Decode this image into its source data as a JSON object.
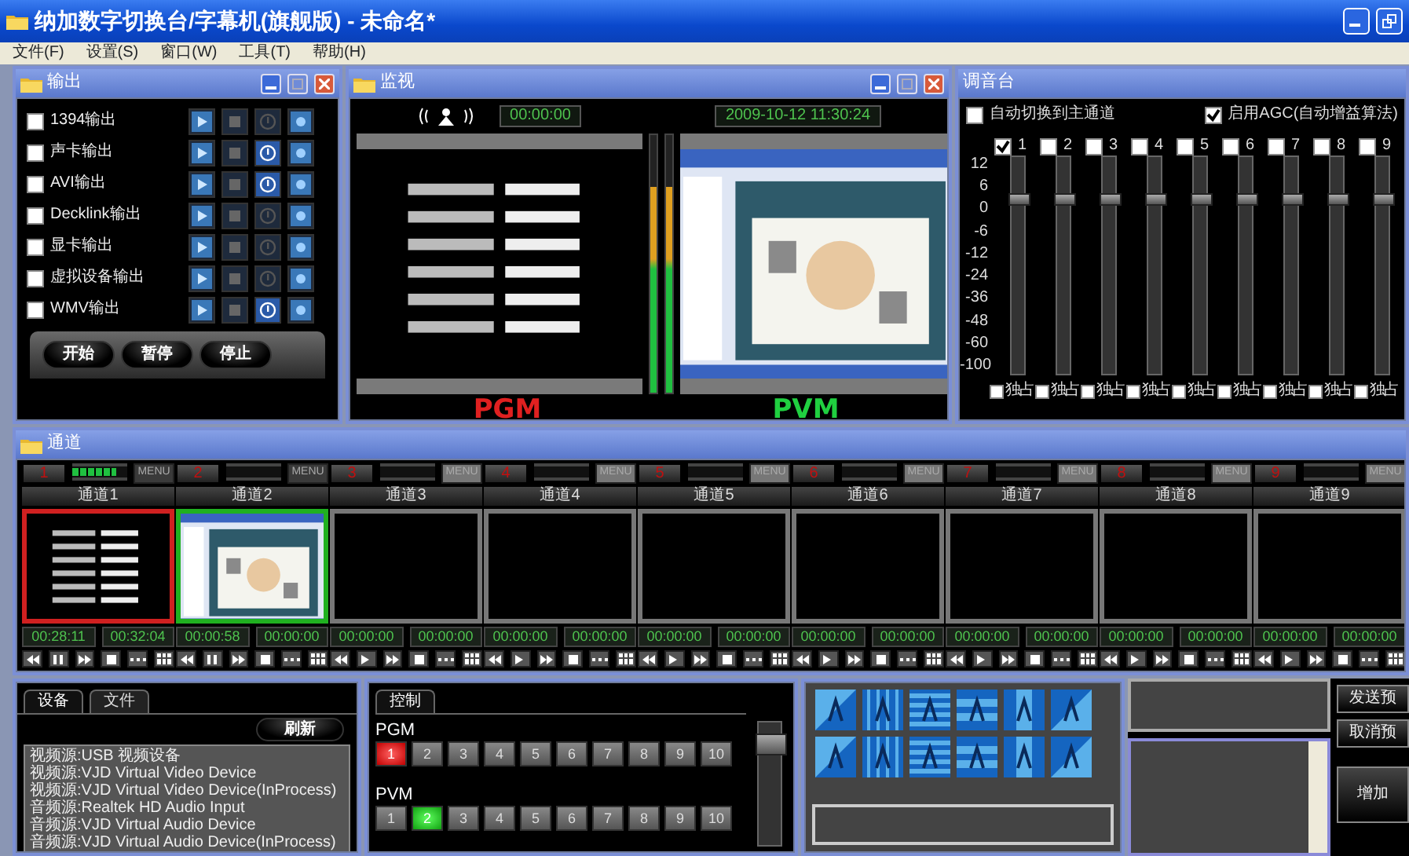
{
  "window": {
    "title": "纳加数字切换台/字幕机(旗舰版) - 未命名*"
  },
  "menu": [
    "文件(F)",
    "设置(S)",
    "窗口(W)",
    "工具(T)",
    "帮助(H)"
  ],
  "output_panel": {
    "title": "输出",
    "outputs": [
      {
        "label": "1394输出",
        "checked": false,
        "info_active": false
      },
      {
        "label": "声卡输出",
        "checked": false,
        "info_active": true
      },
      {
        "label": "AVI输出",
        "checked": false,
        "info_active": true
      },
      {
        "label": "Decklink输出",
        "checked": false,
        "info_active": false
      },
      {
        "label": "显卡输出",
        "checked": false,
        "info_active": false
      },
      {
        "label": "虚拟设备输出",
        "checked": false,
        "info_active": false
      },
      {
        "label": "WMV输出",
        "checked": false,
        "info_active": true
      }
    ],
    "buttons": [
      "开始",
      "暂停",
      "停止"
    ]
  },
  "monitor_panel": {
    "title": "监视",
    "timecode": "00:00:00",
    "datetime": "2009-10-12 11:30:24",
    "meters": [
      {
        "level": 0.8
      },
      {
        "level": 0.8
      }
    ],
    "program_label": "PGM",
    "preview_label": "PVM"
  },
  "mixer_panel": {
    "title": "调音台",
    "auto_switch": {
      "label": "自动切换到主通道",
      "checked": false
    },
    "agc": {
      "label": "启用AGC(自动增益算法)",
      "checked": true
    },
    "scale": [
      "12",
      "6",
      "0",
      "-6",
      "-12",
      "-24",
      "-36",
      "-48",
      "-60",
      "-100"
    ],
    "channels": [
      {
        "label": "1",
        "checked": true,
        "level": 0.82,
        "solo_label": "独占",
        "solo_checked": false
      },
      {
        "label": "2",
        "checked": false,
        "level": 0.82,
        "solo_label": "独占",
        "solo_checked": false
      },
      {
        "label": "3",
        "checked": false,
        "level": 0.82,
        "solo_label": "独占",
        "solo_checked": false
      },
      {
        "label": "4",
        "checked": false,
        "level": 0.82,
        "solo_label": "独占",
        "solo_checked": false
      },
      {
        "label": "5",
        "checked": false,
        "level": 0.82,
        "solo_label": "独占",
        "solo_checked": false
      },
      {
        "label": "6",
        "checked": false,
        "level": 0.82,
        "solo_label": "独占",
        "solo_checked": false
      },
      {
        "label": "7",
        "checked": false,
        "level": 0.82,
        "solo_label": "独占",
        "solo_checked": false
      },
      {
        "label": "8",
        "checked": false,
        "level": 0.82,
        "solo_label": "独占",
        "solo_checked": false
      },
      {
        "label": "9",
        "checked": false,
        "level": 0.82,
        "solo_label": "独占",
        "solo_checked": false
      }
    ]
  },
  "channel_panel": {
    "title": "通道",
    "channels": [
      {
        "number": "1",
        "name": "通道1",
        "menu": "MENU",
        "level": 0.8,
        "on_program": true,
        "on_preview": false,
        "playing": true,
        "has_video": true,
        "in": "00:28:11",
        "out": "00:32:04"
      },
      {
        "number": "2",
        "name": "通道2",
        "menu": "MENU",
        "level": 0,
        "on_program": false,
        "on_preview": true,
        "playing": true,
        "has_video": true,
        "in": "00:00:58",
        "out": "00:00:00"
      },
      {
        "number": "3",
        "name": "通道3",
        "menu": "MENU",
        "level": 0,
        "on_program": false,
        "on_preview": false,
        "has_video": false,
        "playing": false,
        "in": "00:00:00",
        "out": "00:00:00"
      },
      {
        "number": "4",
        "name": "通道4",
        "menu": "MENU",
        "level": 0,
        "on_program": false,
        "on_preview": false,
        "has_video": false,
        "playing": false,
        "in": "00:00:00",
        "out": "00:00:00"
      },
      {
        "number": "5",
        "name": "通道5",
        "menu": "MENU",
        "level": 0,
        "on_program": false,
        "on_preview": false,
        "has_video": false,
        "playing": false,
        "in": "00:00:00",
        "out": "00:00:00"
      },
      {
        "number": "6",
        "name": "通道6",
        "menu": "MENU",
        "level": 0,
        "on_program": false,
        "on_preview": false,
        "has_video": false,
        "playing": false,
        "in": "00:00:00",
        "out": "00:00:00"
      },
      {
        "number": "7",
        "name": "通道7",
        "menu": "MENU",
        "level": 0,
        "on_program": false,
        "on_preview": false,
        "has_video": false,
        "playing": false,
        "in": "00:00:00",
        "out": "00:00:00"
      },
      {
        "number": "8",
        "name": "通道8",
        "menu": "MENU",
        "level": 0,
        "on_program": false,
        "on_preview": false,
        "has_video": false,
        "playing": false,
        "in": "00:00:00",
        "out": "00:00:00"
      },
      {
        "number": "9",
        "name": "通道9",
        "menu": "MENU",
        "level": 0,
        "on_program": false,
        "on_preview": false,
        "has_video": false,
        "playing": false,
        "in": "00:00:00",
        "out": "00:00:00"
      }
    ]
  },
  "source_panel": {
    "tabs": [
      {
        "label": "设备",
        "selected": true
      },
      {
        "label": "文件",
        "selected": false
      }
    ],
    "refresh": "刷新",
    "devices": [
      "视频源:USB 视频设备",
      "视频源:VJD Virtual Video Device",
      "视频源:VJD Virtual Video Device(InProcess)",
      "音频源:Realtek HD Audio Input",
      "音频源:VJD Virtual Audio Device",
      "音频源:VJD Virtual Audio Device(InProcess)"
    ]
  },
  "control_panel": {
    "tab": "控制",
    "program_label": "PGM",
    "preview_label": "PVM",
    "program_buttons": [
      {
        "label": "1",
        "selected": true
      },
      {
        "label": "2",
        "selected": false
      },
      {
        "label": "3",
        "selected": false
      },
      {
        "label": "4",
        "selected": false
      },
      {
        "label": "5",
        "selected": false
      },
      {
        "label": "6",
        "selected": false
      },
      {
        "label": "7",
        "selected": false
      },
      {
        "label": "8",
        "selected": false
      },
      {
        "label": "9",
        "selected": false
      },
      {
        "label": "10",
        "selected": false
      }
    ],
    "preview_buttons": [
      {
        "label": "1",
        "selected": false
      },
      {
        "label": "2",
        "selected": true
      },
      {
        "label": "3",
        "selected": false
      },
      {
        "label": "4",
        "selected": false
      },
      {
        "label": "5",
        "selected": false
      },
      {
        "label": "6",
        "selected": false
      },
      {
        "label": "7",
        "selected": false
      },
      {
        "label": "8",
        "selected": false
      },
      {
        "label": "9",
        "selected": false
      },
      {
        "label": "10",
        "selected": false
      }
    ],
    "transition_bar": {
      "level": 0.9
    }
  },
  "caption_panel": {
    "buttons": [
      "发送预",
      "取消预",
      "增加"
    ]
  }
}
